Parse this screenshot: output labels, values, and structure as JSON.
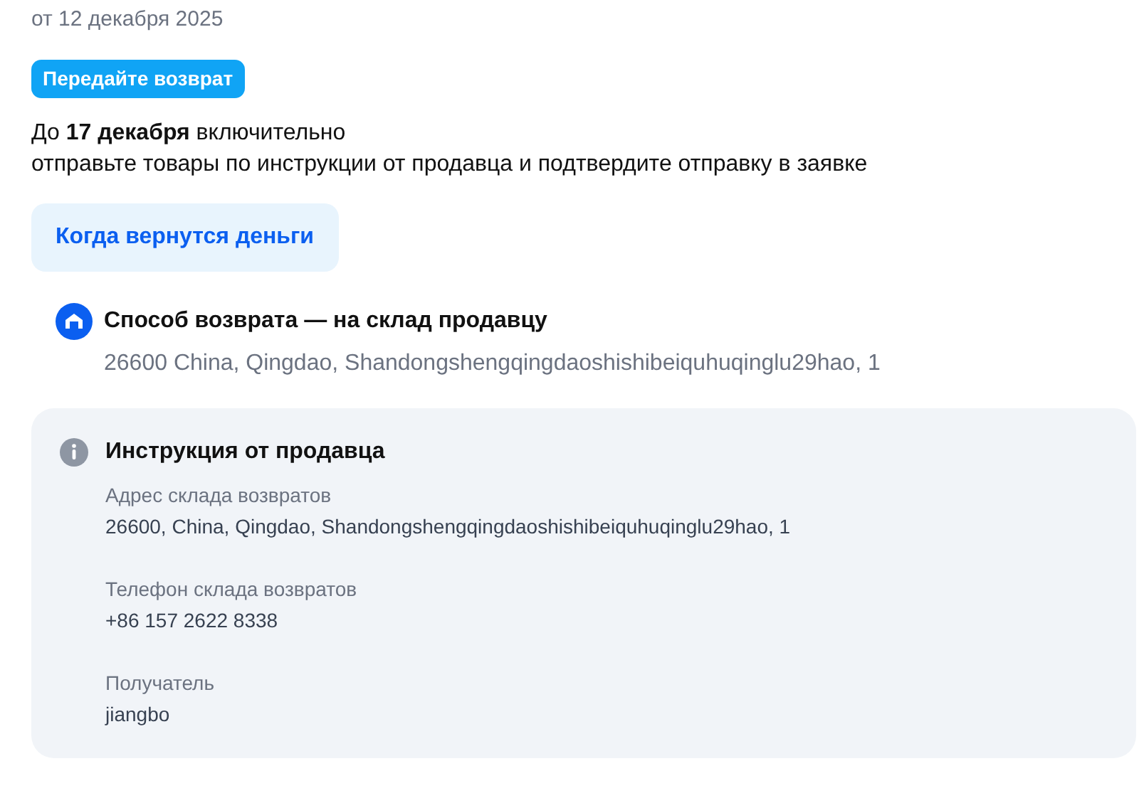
{
  "order_date": "от 12 декабря 2025",
  "status_badge": "Передайте возврат",
  "deadline": "До **17 декабря** включительно",
  "instruction": "отправьте товары по инструкции от продавца и подтвердите отправку в заявке",
  "refund_button": "Когда вернутся деньги",
  "return_method": {
    "title": "Способ возврата — на склад продавцу",
    "address": "26600 China, Qingdao, Shandongshengqingdaoshishibeiquhuqinglu29hao, 1"
  },
  "seller_instructions": {
    "title": "Инструкция от продавца",
    "fields": [
      {
        "label": "Адрес склада возвратов",
        "value": "26600, China, Qingdao, Shandongshengqingdaoshishibeiquhuqinglu29hao, 1"
      },
      {
        "label": "Телефон склада возвратов",
        "value": "+86 157 2622 8338"
      },
      {
        "label": "Получатель",
        "value": "jiangbo"
      }
    ]
  }
}
